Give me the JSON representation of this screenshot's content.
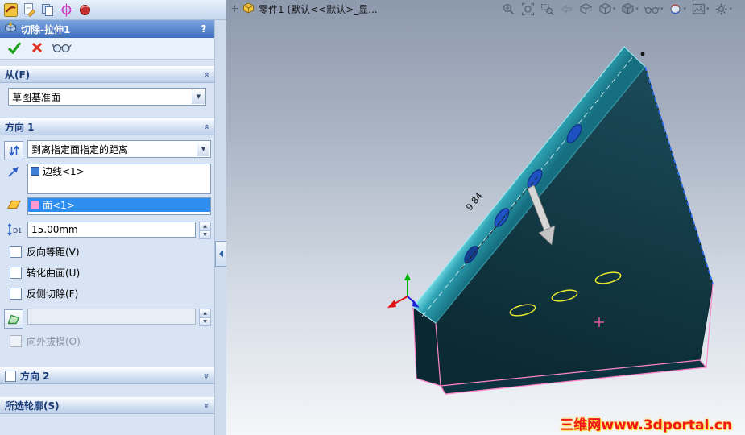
{
  "window": {
    "toolbar_icons": [
      "app-logo-icon",
      "sketch-doc-icon",
      "sheets-icon",
      "target-icon",
      "motion-sphere-icon"
    ]
  },
  "panel": {
    "title": "切除-拉伸1",
    "help": "?",
    "from": {
      "header": "从(F)",
      "plane_value": "草图基准面"
    },
    "dir1": {
      "header": "方向 1",
      "end_condition": "到离指定面指定的距离",
      "edge_item": "边线<1>",
      "face_item": "面<1>",
      "distance": "15.00mm",
      "d1_label": "D1",
      "draft_value": "",
      "cb_reverse_offset": "反向等距(V)",
      "cb_translate_surface": "转化曲面(U)",
      "cb_flip_side": "反侧切除(F)",
      "cb_draft_outward": "向外拔模(O)"
    },
    "dir2": {
      "header": "方向 2"
    },
    "contours": {
      "header": "所选轮廓(S)"
    }
  },
  "viewport": {
    "doc_title": "零件1 (默认<<默认>_显...",
    "dimension": "9.84",
    "watermark": "三维网www.3dportal.cn",
    "toolbar_icons": [
      "zoom-in-icon",
      "zoom-fit-icon",
      "zoom-area-icon",
      "previous-view-icon",
      "section-view-icon",
      "view-orientation-icon",
      "display-style-icon",
      "hide-show-items-icon",
      "edit-appearance-icon",
      "apply-scene-icon",
      "view-settings-icon"
    ]
  },
  "colors": {
    "selection_blue": "#2e8ef0",
    "face_tag_pink": "#ff9ad5",
    "edge_tag_blue": "#3f7fd6",
    "model_teal": "#1d7f92",
    "edge_highlight_pink": "#ff86c8",
    "hole_blue": "#1d52c0",
    "sketch_yellow": "#e6e62e",
    "watermark_red": "#f01818"
  }
}
